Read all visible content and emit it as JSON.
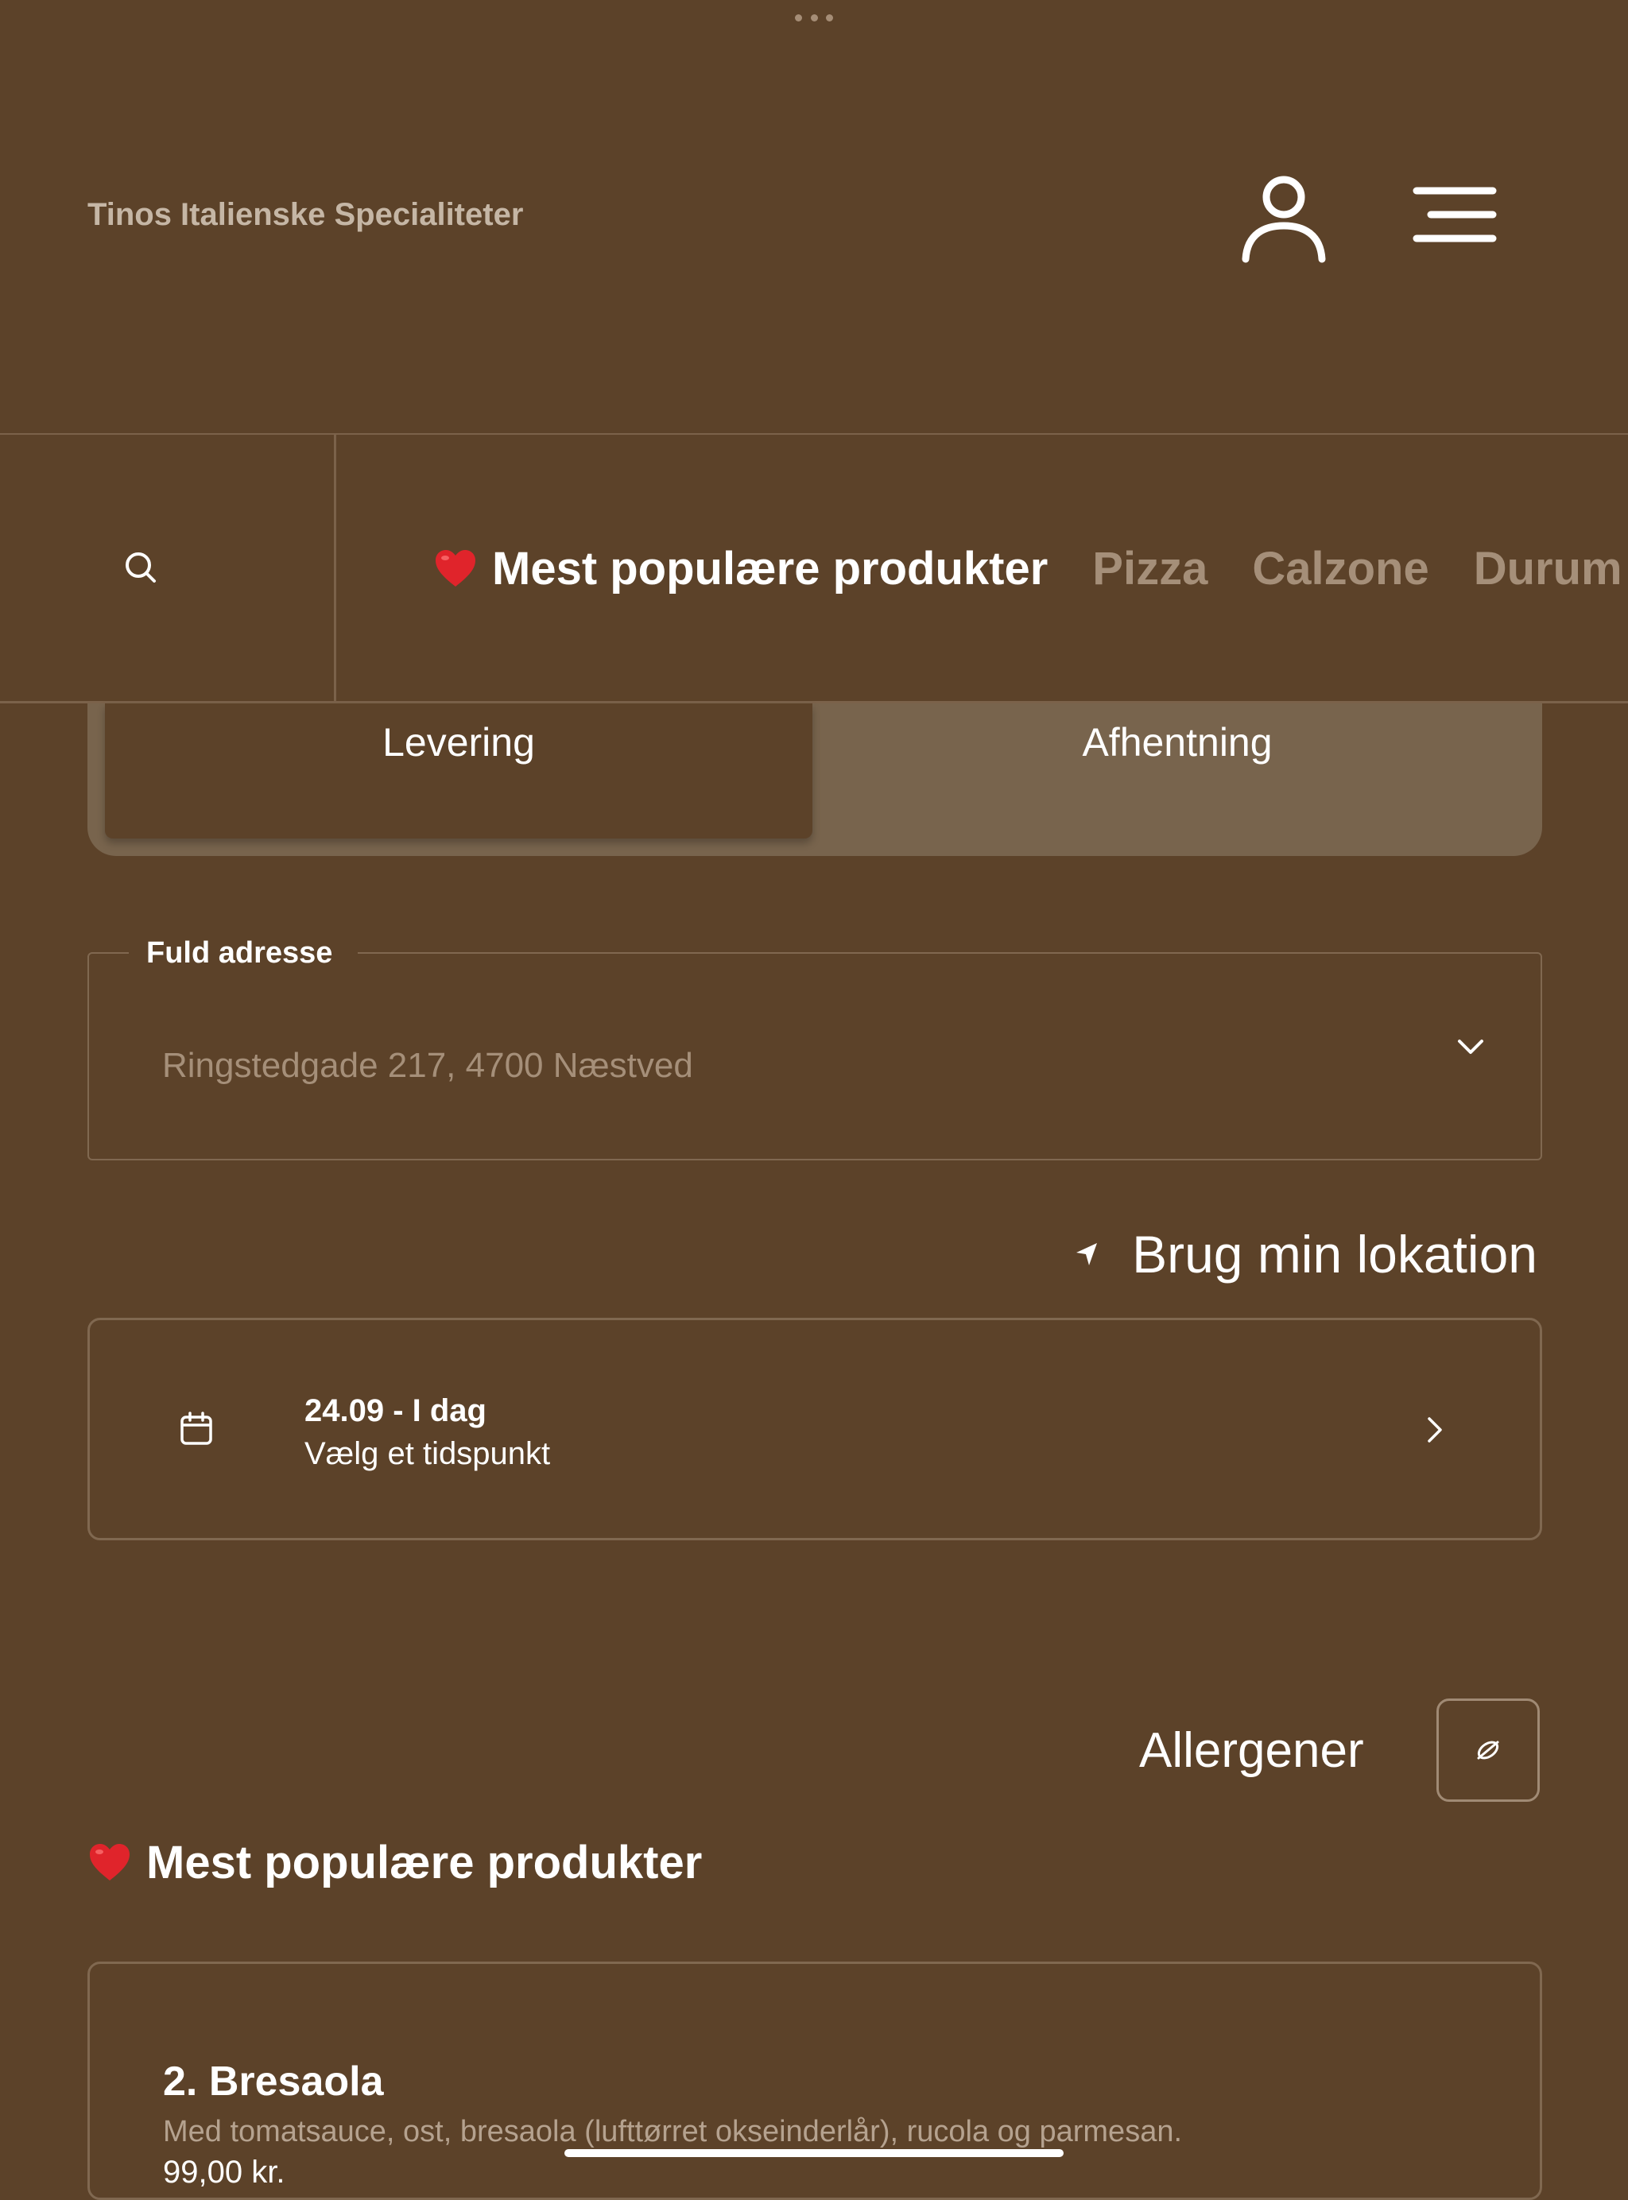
{
  "header": {
    "store_name": "Tinos Italienske Specialiteter"
  },
  "categories": {
    "items": [
      {
        "label": "Mest populære produkter",
        "icon": "heart-icon",
        "active": true
      },
      {
        "label": "Pizza",
        "active": false
      },
      {
        "label": "Calzone",
        "active": false
      },
      {
        "label": "Durum",
        "active": false
      }
    ]
  },
  "order_type": {
    "delivery_label": "Levering",
    "pickup_label": "Afhentning",
    "selected": "Levering"
  },
  "address": {
    "label": "Fuld adresse",
    "placeholder": "Ringstedgade 217, 4700 Næstved"
  },
  "location": {
    "label": "Brug min lokation"
  },
  "schedule": {
    "date": "24.09 - I dag",
    "subtitle": "Vælg et tidspunkt"
  },
  "allergens": {
    "label": "Allergener"
  },
  "section": {
    "title": "Mest populære produkter"
  },
  "products": [
    {
      "name": "2. Bresaola",
      "description": "Med tomatsauce, ost, bresaola (lufttørret okseinderlår), rucola og parmesan.",
      "price": "99,00 kr."
    }
  ],
  "colors": {
    "background": "#5c4229",
    "toggle_track": "#78644d",
    "border": "#806850",
    "muted_text": "#a58f79",
    "heart": "#e0242b"
  }
}
